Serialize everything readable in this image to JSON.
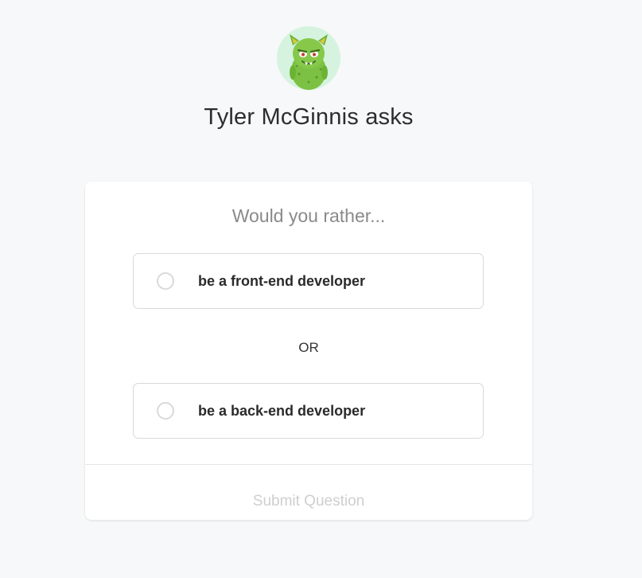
{
  "header": {
    "avatar_icon": "green-monster-avatar-icon",
    "asker_text": "Tyler McGinnis asks"
  },
  "poll": {
    "prompt": "Would you rather...",
    "options": [
      {
        "label": "be a front-end developer",
        "selected": false
      },
      {
        "label": "be a back-end developer",
        "selected": false
      }
    ],
    "separator": "OR",
    "submit_label": "Submit Question",
    "submit_enabled": false
  },
  "colors": {
    "page_background": "#f7f8fa",
    "card_background": "#ffffff",
    "avatar_background": "#d5f3de",
    "monster_green": "#7cc143",
    "submit_disabled_text": "#cfcfcf"
  }
}
